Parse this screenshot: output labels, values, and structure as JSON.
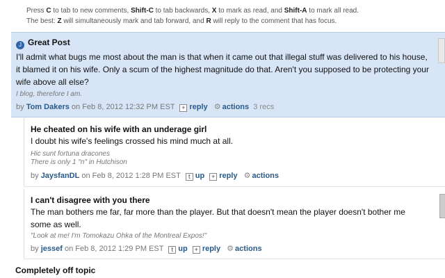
{
  "help": {
    "line1": [
      "Press ",
      "C",
      " to tab to new comments, ",
      "Shift-C",
      " to tab backwards, ",
      "X",
      " to mark as read, and ",
      "Shift-A",
      " to mark all read."
    ],
    "line2": [
      "The best: ",
      "Z",
      " will simultaneously mark and tab forward, and ",
      "R",
      " will reply to the comment that has focus."
    ]
  },
  "comments": [
    {
      "title": "Great Post",
      "body": "I'll admit what bugs me most about the man is that when it came out that illegal stuff was delivered to his house, it blamed it on his wife. Only a scum of the highest magnitude do that. Aren't you supposed to be protecting your wife above all else?",
      "signature": [
        "I blog, therefore I am."
      ],
      "by": "by",
      "author": "Tom Dakers",
      "date": "on Feb 8, 2012 12:32 PM EST",
      "reply": "reply",
      "actions": "actions",
      "recs": "3 recs"
    },
    {
      "title": "He cheated on his wife with an underage girl",
      "body": "I doubt his wife's feelings crossed his mind much at all.",
      "signature": [
        "Hic sunt fortuna dracones",
        "There is only 1 \"n\" in Hutchison"
      ],
      "by": "by",
      "author": "JaysfanDL",
      "date": "on Feb 8, 2012 1:28 PM EST",
      "up": "up",
      "reply": "reply",
      "actions": "actions"
    },
    {
      "title": "I can't disagree with you there",
      "body": "The man bothers me far, far more than the player. But that doesn't mean the player doesn't bother me some as well.",
      "signature": [
        "\"Look at me! I'm Tomokazu Ohka of the Montreal Expos!\""
      ],
      "by": "by",
      "author": "jessef",
      "date": "on Feb 8, 2012 1:29 PM EST",
      "up": "up",
      "reply": "reply",
      "actions": "actions"
    },
    {
      "title": "Completely off topic"
    }
  ],
  "icons": {
    "plus": "+",
    "up": "t",
    "gear": "⚙",
    "team": "J"
  },
  "colors": {
    "highlight": "#d8e5f7",
    "link": "#2a5a8a"
  }
}
